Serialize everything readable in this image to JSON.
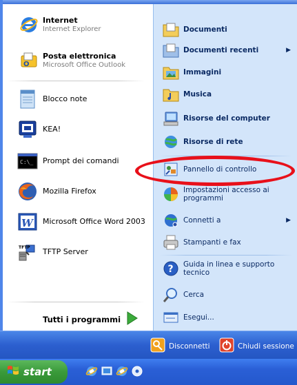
{
  "left_pinned": [
    {
      "title": "Internet",
      "subtitle": "Internet Explorer",
      "icon": "internet-explorer-icon"
    },
    {
      "title": "Posta elettronica",
      "subtitle": "Microsoft Office Outlook",
      "icon": "outlook-icon"
    }
  ],
  "left_recent": [
    {
      "label": "Blocco note",
      "icon": "notepad-icon"
    },
    {
      "label": "KEA!",
      "icon": "terminal-emulator-icon"
    },
    {
      "label": "Prompt dei comandi",
      "icon": "command-prompt-icon"
    },
    {
      "label": "Mozilla Firefox",
      "icon": "firefox-icon"
    },
    {
      "label": "Microsoft Office Word 2003",
      "icon": "word-icon"
    },
    {
      "label": "TFTP Server",
      "icon": "tftp-server-icon"
    }
  ],
  "all_programs_label": "Tutti i programmi",
  "right_items": [
    {
      "label": "Documenti",
      "icon": "documents-folder-icon",
      "bold": true
    },
    {
      "label": "Documenti recenti",
      "icon": "recent-documents-icon",
      "bold": true,
      "submenu": true
    },
    {
      "label": "Immagini",
      "icon": "pictures-folder-icon",
      "bold": true
    },
    {
      "label": "Musica",
      "icon": "music-folder-icon",
      "bold": true
    },
    {
      "label": "Risorse del computer",
      "icon": "my-computer-icon",
      "bold": true
    },
    {
      "label": "Risorse di rete",
      "icon": "network-places-icon",
      "bold": true
    },
    {
      "label": "Pannello di controllo",
      "icon": "control-panel-icon"
    },
    {
      "label": "Impostazioni accesso ai programmi",
      "icon": "program-access-icon"
    },
    {
      "label": "Connetti a",
      "icon": "connect-to-icon",
      "submenu": true
    },
    {
      "label": "Stampanti e fax",
      "icon": "printers-fax-icon"
    },
    {
      "label": "Guida in linea e supporto tecnico",
      "icon": "help-icon"
    },
    {
      "label": "Cerca",
      "icon": "search-icon"
    },
    {
      "label": "Esegui...",
      "icon": "run-icon"
    }
  ],
  "bottom": {
    "logoff_label": "Disconnetti",
    "shutdown_label": "Chiudi sessione"
  },
  "taskbar": {
    "start_label": "start"
  },
  "colors": {
    "highlight_ring": "#e8101a",
    "right_panel_bg": "#d3e5fa",
    "bar_blue": "#2c5fcf",
    "start_green": "#3a9a3a"
  }
}
